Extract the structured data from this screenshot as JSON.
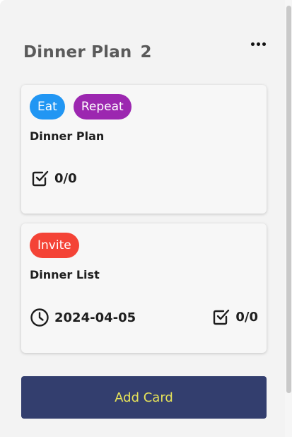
{
  "column": {
    "title": "Dinner Plan",
    "count": "2"
  },
  "cards": [
    {
      "tags": [
        {
          "label": "Eat",
          "color": "#2196f3"
        },
        {
          "label": "Repeat",
          "color": "#9c27b0"
        }
      ],
      "title": "Dinner Plan",
      "checklist": "0/0"
    },
    {
      "tags": [
        {
          "label": "Invite",
          "color": "#f44336"
        }
      ],
      "title": "Dinner List",
      "due_date": "2024-04-05",
      "checklist": "0/0"
    }
  ],
  "add_card_label": "Add Card",
  "colors": {
    "column_bg": "#f3f3f3",
    "card_bg": "#f7f7f7",
    "button_bg": "#333e6e",
    "button_text": "#e6e259",
    "header_text": "#5a5a5a"
  },
  "icons": [
    "menu-dots-icon",
    "checkbox-icon",
    "clock-icon"
  ]
}
